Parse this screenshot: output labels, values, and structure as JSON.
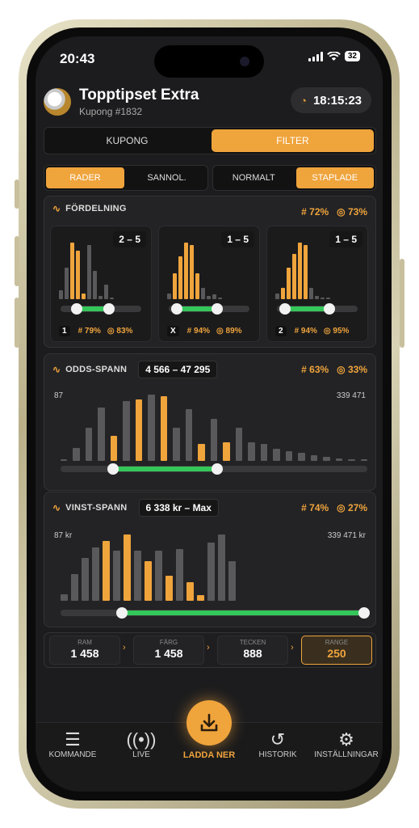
{
  "status_bar": {
    "time": "20:43",
    "battery": "32"
  },
  "header": {
    "title": "Topptipset Extra",
    "subtitle": "Kupong #1832",
    "timer": "18:15:23",
    "logo": "football-logo",
    "timer_icon": "stopwatch-icon"
  },
  "main_tabs": [
    {
      "label": "KUPONG",
      "active": false
    },
    {
      "label": "FILTER",
      "active": true
    }
  ],
  "mode_toggle": [
    {
      "label": "RADER",
      "active": true
    },
    {
      "label": "SANNOL.",
      "active": false
    }
  ],
  "view_toggle": [
    {
      "label": "NORMALT",
      "active": false
    },
    {
      "label": "STAPLADE",
      "active": true
    }
  ],
  "colors": {
    "accent": "#efa43c",
    "green": "#34c759",
    "bar_gray": "#59595b"
  },
  "fordelning": {
    "title": "FÖRDELNING",
    "stat_hash": "# 72%",
    "stat_prob": "◎ 73%",
    "cards": [
      {
        "symbol": "1",
        "range": "2 – 5",
        "stat_hash": "# 79%",
        "stat_prob": "◎ 83%",
        "bars": [
          {
            "v": 0.15,
            "h": false
          },
          {
            "v": 0.55,
            "h": false
          },
          {
            "v": 1.0,
            "h": true
          },
          {
            "v": 0.85,
            "h": true
          },
          {
            "v": 0.1,
            "h": true
          },
          {
            "v": 0.95,
            "h": false
          },
          {
            "v": 0.5,
            "h": false
          },
          {
            "v": 0.05,
            "h": false
          },
          {
            "v": 0.25,
            "h": false
          },
          {
            "v": 0.03,
            "h": false
          }
        ],
        "slider": [
          0.2,
          0.6
        ]
      },
      {
        "symbol": "X",
        "range": "1 – 5",
        "stat_hash": "# 94%",
        "stat_prob": "◎ 89%",
        "bars": [
          {
            "v": 0.1,
            "h": false
          },
          {
            "v": 0.45,
            "h": true
          },
          {
            "v": 0.75,
            "h": true
          },
          {
            "v": 1.0,
            "h": true
          },
          {
            "v": 0.95,
            "h": true
          },
          {
            "v": 0.45,
            "h": true
          },
          {
            "v": 0.2,
            "h": false
          },
          {
            "v": 0.05,
            "h": false
          },
          {
            "v": 0.08,
            "h": false
          },
          {
            "v": 0.03,
            "h": false
          }
        ],
        "slider": [
          0.1,
          0.6
        ]
      },
      {
        "symbol": "2",
        "range": "1 – 5",
        "stat_hash": "# 94%",
        "stat_prob": "◎ 95%",
        "bars": [
          {
            "v": 0.1,
            "h": false
          },
          {
            "v": 0.2,
            "h": true
          },
          {
            "v": 0.55,
            "h": true
          },
          {
            "v": 0.8,
            "h": true
          },
          {
            "v": 1.0,
            "h": true
          },
          {
            "v": 0.95,
            "h": true
          },
          {
            "v": 0.2,
            "h": false
          },
          {
            "v": 0.05,
            "h": false
          },
          {
            "v": 0.03,
            "h": false
          },
          {
            "v": 0.02,
            "h": false
          }
        ],
        "slider": [
          0.1,
          0.65
        ]
      }
    ]
  },
  "odds_spann": {
    "title": "ODDS-SPANN",
    "range": "4 566 – 47 295",
    "stat_hash": "# 63%",
    "stat_prob": "◎ 33%",
    "min_label": "87",
    "max_label": "339 471",
    "bars": [
      {
        "v": 0.02,
        "h": false
      },
      {
        "v": 0.2,
        "h": false
      },
      {
        "v": 0.5,
        "h": false
      },
      {
        "v": 0.8,
        "h": false
      },
      {
        "v": 0.38,
        "h": true
      },
      {
        "v": 0.9,
        "h": false
      },
      {
        "v": 0.93,
        "h": true
      },
      {
        "v": 1.0,
        "h": false
      },
      {
        "v": 0.98,
        "h": true
      },
      {
        "v": 0.5,
        "h": false
      },
      {
        "v": 0.78,
        "h": false
      },
      {
        "v": 0.25,
        "h": true
      },
      {
        "v": 0.63,
        "h": false
      },
      {
        "v": 0.28,
        "h": true
      },
      {
        "v": 0.5,
        "h": false
      },
      {
        "v": 0.28,
        "h": false
      },
      {
        "v": 0.25,
        "h": false
      },
      {
        "v": 0.18,
        "h": false
      },
      {
        "v": 0.15,
        "h": false
      },
      {
        "v": 0.12,
        "h": false
      },
      {
        "v": 0.08,
        "h": false
      },
      {
        "v": 0.06,
        "h": false
      },
      {
        "v": 0.04,
        "h": false
      },
      {
        "v": 0.03,
        "h": false
      },
      {
        "v": 0.02,
        "h": false
      }
    ],
    "slider": [
      0.17,
      0.51
    ]
  },
  "vinst_spann": {
    "title": "VINST-SPANN",
    "range": "6 338 kr – Max",
    "stat_hash": "# 74%",
    "stat_prob": "◎ 27%",
    "min_label": "87 kr",
    "max_label": "339 471 kr",
    "bars": [
      {
        "v": 0.1,
        "h": false
      },
      {
        "v": 0.4,
        "h": false
      },
      {
        "v": 0.65,
        "h": false
      },
      {
        "v": 0.8,
        "h": false
      },
      {
        "v": 0.9,
        "h": true
      },
      {
        "v": 0.76,
        "h": false
      },
      {
        "v": 1.0,
        "h": true
      },
      {
        "v": 0.76,
        "h": false
      },
      {
        "v": 0.6,
        "h": true
      },
      {
        "v": 0.75,
        "h": false
      },
      {
        "v": 0.38,
        "h": true
      },
      {
        "v": 0.78,
        "h": false
      },
      {
        "v": 0.28,
        "h": true
      },
      {
        "v": 0.08,
        "h": true
      },
      {
        "v": 0.88,
        "h": false
      },
      {
        "v": 1.0,
        "h": false
      },
      {
        "v": 0.6,
        "h": false
      }
    ],
    "slider": [
      0.2,
      0.99
    ]
  },
  "counters": [
    {
      "label": "RAM",
      "value": "1 458",
      "active": false
    },
    {
      "label": "FÄRG",
      "value": "1 458",
      "active": false
    },
    {
      "label": "TECKEN",
      "value": "888",
      "active": false
    },
    {
      "label": "RANGE",
      "value": "250",
      "active": true
    }
  ],
  "nav": {
    "items": [
      {
        "label": "KOMMANDE",
        "icon": "list-icon"
      },
      {
        "label": "LIVE",
        "icon": "broadcast-icon"
      },
      {
        "label": "HISTORIK",
        "icon": "history-icon"
      },
      {
        "label": "INSTÄLLNINGAR",
        "icon": "gear-icon"
      }
    ],
    "fab_label": "LADDA NER",
    "fab_icon": "download-icon"
  }
}
